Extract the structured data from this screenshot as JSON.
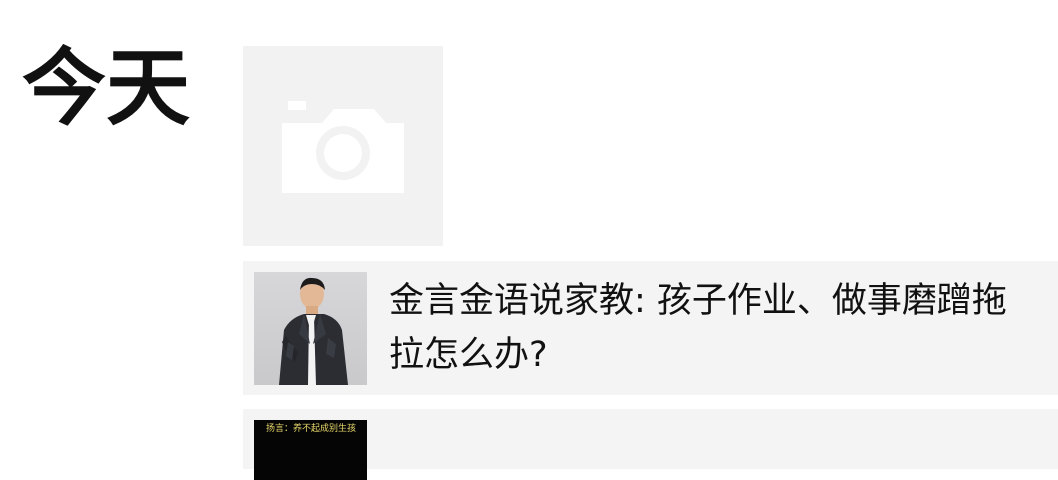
{
  "feed": {
    "date_label": "今天",
    "photo_placeholder_icon": "camera-icon",
    "shares": [
      {
        "title": "金言金语说家教: 孩子作业、做事磨蹭拖拉怎么办?",
        "thumbnail": "man-portrait-thumbnail"
      },
      {
        "title": "",
        "thumbnail_caption": "扬言：养不起成别生孩"
      }
    ]
  },
  "colors": {
    "card_background": "#f4f4f4",
    "placeholder_background": "#f2f2f2",
    "camera_icon": "#ffffff",
    "caption": "#e8d86a"
  }
}
